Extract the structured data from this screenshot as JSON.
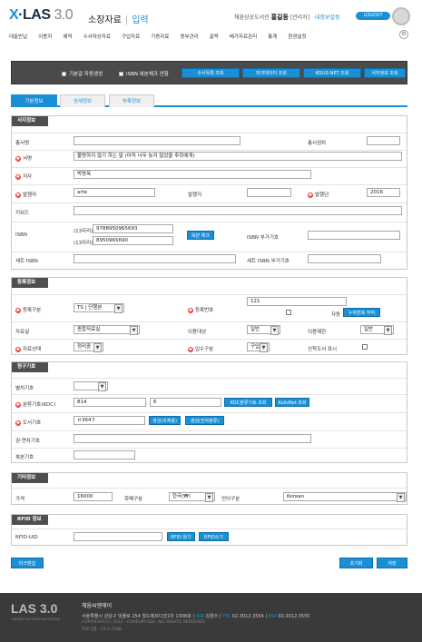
{
  "brand": {
    "logo_x": "X",
    "logo_text": "LAS",
    "logo_version": "3.0"
  },
  "header": {
    "title": "소장자료",
    "separator": "|",
    "subtitle": "입력",
    "library": "채움상상도서관",
    "user": "홍길동",
    "role": "[관리자]",
    "account_link": "내정보설정",
    "logout": "LOGOUT"
  },
  "menu": [
    "대출반납",
    "이용자",
    "예약",
    "수서대상자료",
    "구입자료",
    "기증자료",
    "원부관리",
    "출력",
    "배가자료관리",
    "통계",
    "환경설정"
  ],
  "toolbar": {
    "chk1": "기본값 자동생성",
    "chk2": "ISBN 복본체크 안함",
    "btn1": "수서목록 조회",
    "btn2": "마크데이터 조회",
    "btn3": "KOLIS-NET 조회",
    "btn4": "서지정보 조회"
  },
  "tabs": [
    "기본정보",
    "상세정보",
    "부록정보"
  ],
  "bib": {
    "header": "서지정보",
    "series_label": "총서명",
    "series_value": "",
    "series_no_label": "총서권차",
    "series_no_value": "",
    "title_label": "서명",
    "title_value": "불량하지 않기 하는 말 (아직 너무 늦지 않았을 후회에게)",
    "author_label": "저자",
    "author_value": "박명옥",
    "publisher_label": "발행자",
    "publisher_value": "arte",
    "place_label": "발행지",
    "place_value": "",
    "year_label": "발행년",
    "year_value": "2016",
    "keyword_label": "키워드",
    "keyword_value": "",
    "isbn_label": "ISBN",
    "isbn13_label": "(13자리)",
    "isbn13_value": "9788950965693",
    "isbn10_label": "(13자리)",
    "isbn10_value": "8950965690",
    "dup_check": "복본 체크",
    "isbn_add_label": "ISBN 부가기호",
    "isbn_add_value": "",
    "set_isbn_label": "세트 ISBN",
    "set_isbn_value": "",
    "set_isbn_add_label": "세트 ISBN 부가기호",
    "set_isbn_add_value": ""
  },
  "reg": {
    "header": "등록정보",
    "reg_type_label": "등록구분",
    "reg_type_value": "TS | 단행본",
    "reg_no_label": "등록번호",
    "reg_no_value": "121",
    "auto_label": "자동",
    "auto_btn": "누락번호 부여",
    "material_label": "자료실",
    "material_value": "종합자료실",
    "target_label": "이용대상",
    "target_value": "일반",
    "limit_label": "이용제한",
    "limit_value": "일반",
    "status_label": "자료상태",
    "status_value": "정리중",
    "acq_label": "입수구분",
    "acq_value": "구입",
    "new_label": "신착도서 표시"
  },
  "call": {
    "header": "청구기호",
    "sep_label": "별치기호",
    "sep_value": "",
    "class_label": "분류기호(KDC)",
    "class_value": "814",
    "class_value2": "6",
    "btn_kdc": "KDC분류기호 조회",
    "btn_kolis": "KolisNet 조회",
    "book_label": "도서기호",
    "book_value": "ㅂ364ㅎ",
    "btn_auto": "생성(자체용)",
    "btn_auto2": "생성(전자분류)",
    "vol_label": "권·면차기호",
    "vol_value": "",
    "copy_label": "복본기호",
    "copy_value": ""
  },
  "etc": {
    "header": "기타정보",
    "price_label": "가격",
    "price_value": "16000",
    "currency_label": "화폐구분",
    "currency_value": "한국(₩)",
    "lang_label": "언어구분",
    "lang_value": "Korean"
  },
  "rfid": {
    "header": "RFID 정보",
    "uid_label": "RFID-UID",
    "uid_value": "",
    "btn_read": "RFID 읽기",
    "btn_write": "RFID쓰기"
  },
  "actions": {
    "marc": "마크편집",
    "reset": "초기화",
    "save": "저장"
  },
  "footer": {
    "logo": "LAS 3.0",
    "small": "LIBRARY AUTOMATION SYSTEM",
    "company": "채움씨앤에이",
    "address": "서울특별시 강남구 빗물로 254 월드메르디앙1차 1308호 |",
    "ceo": "대표",
    "ceo_name": "김형수",
    "tel": "TEL",
    "tel_value": "02.3012.3554",
    "fax": "FAX",
    "fax_value": "02.3012.3555",
    "copyright": "COPYRIGHT(C) 2012 - CHAEUM C&A. ALL RIGHTS RESERVED.",
    "version": "프로그램 : 03.2.7188"
  }
}
